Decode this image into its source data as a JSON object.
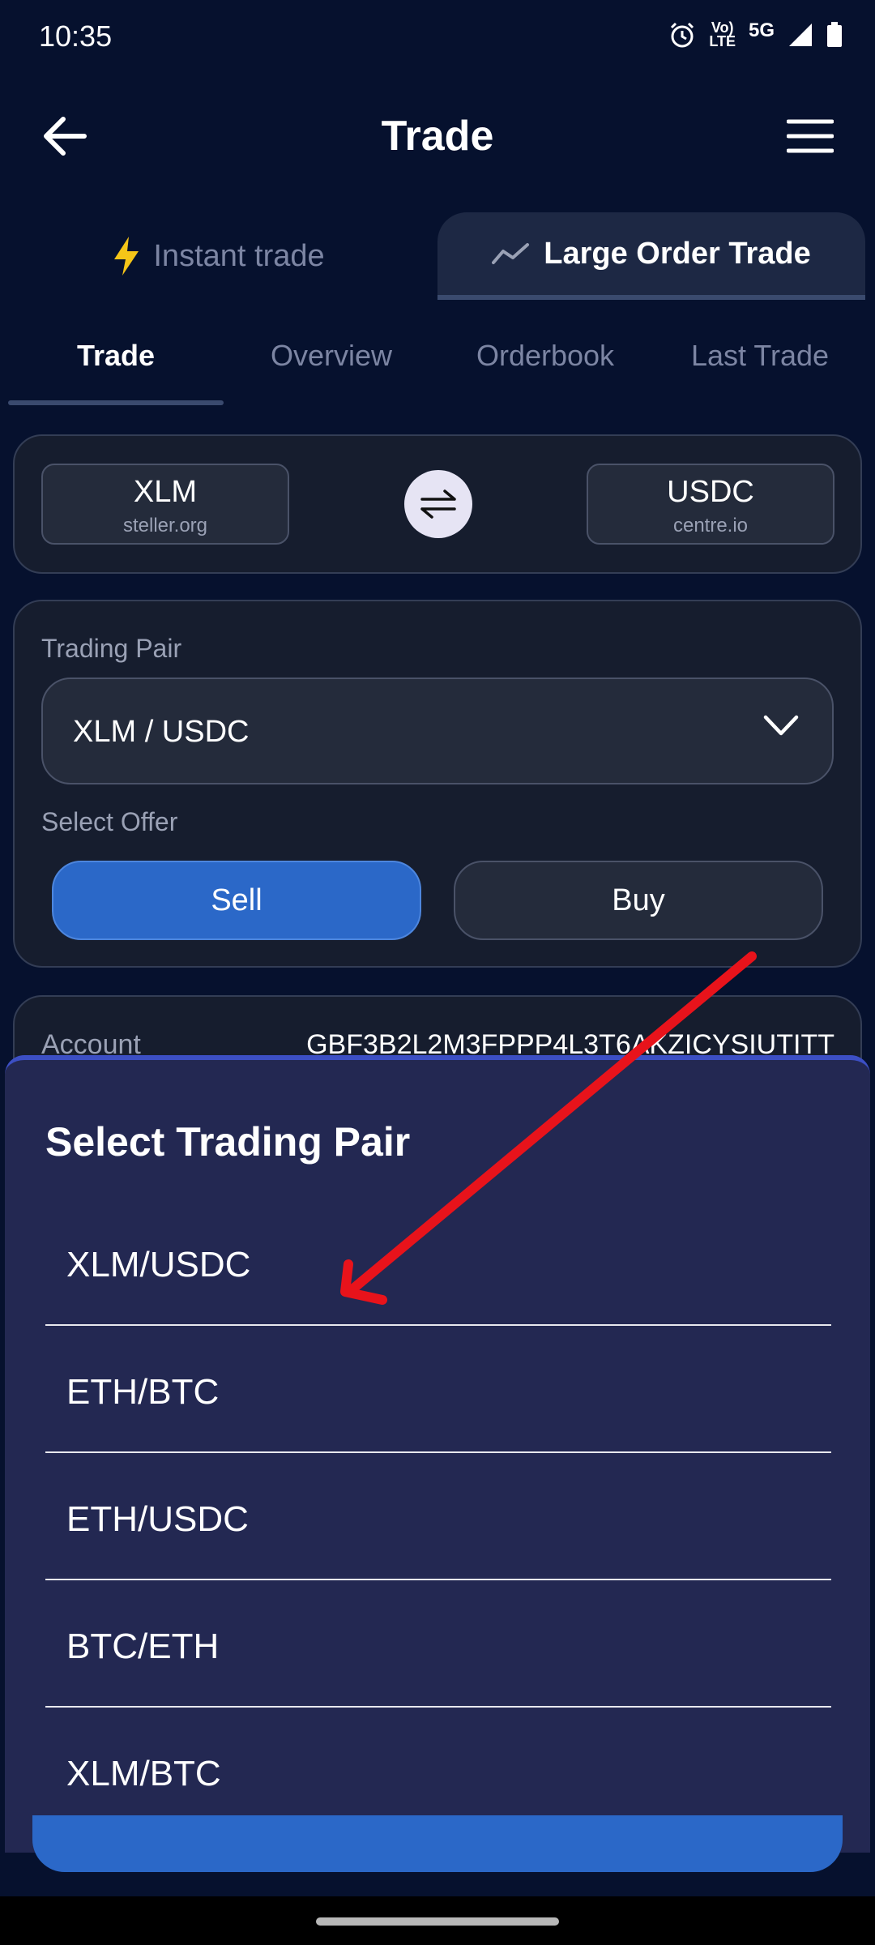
{
  "status_bar": {
    "time": "10:35",
    "lte_top": "Vo)",
    "lte_bottom": "LTE",
    "network": "5G",
    "icons": [
      "alarm-icon",
      "volte-icon",
      "signal-icon",
      "battery-icon"
    ]
  },
  "header": {
    "title": "Trade",
    "back_icon": "arrow-left-icon",
    "menu_icon": "hamburger-menu-icon"
  },
  "mode_tabs": [
    {
      "label": "Instant trade",
      "icon": "lightning-icon",
      "active": false
    },
    {
      "label": "Large Order Trade",
      "icon": "chart-line-icon",
      "active": true
    }
  ],
  "sub_tabs": [
    {
      "label": "Trade",
      "active": true
    },
    {
      "label": "Overview",
      "active": false
    },
    {
      "label": "Orderbook",
      "active": false
    },
    {
      "label": "Last Trade",
      "active": false
    }
  ],
  "assets": {
    "from": {
      "code": "XLM",
      "domain": "steller.org"
    },
    "to": {
      "code": "USDC",
      "domain": "centre.io"
    },
    "swap_icon": "swap-arrows-icon"
  },
  "trading_pair": {
    "label": "Trading Pair",
    "selected": "XLM / USDC"
  },
  "offer": {
    "label": "Select Offer",
    "sell_label": "Sell",
    "buy_label": "Buy",
    "selected": "Sell"
  },
  "account": {
    "label": "Account",
    "value": "GBF3B2L2M3FPPP4L3T6AKZICYSIUTITT"
  },
  "sheet": {
    "title": "Select Trading Pair",
    "items": [
      "XLM/USDC",
      "ETH/BTC",
      "ETH/USDC",
      "BTC/ETH",
      "XLM/BTC"
    ]
  },
  "colors": {
    "background": "#06112e",
    "card": "#161d2e",
    "sheet": "#232852",
    "accent_blue": "#2b68c8",
    "lightning": "#f5c518",
    "annotation_red": "#e8131b"
  }
}
